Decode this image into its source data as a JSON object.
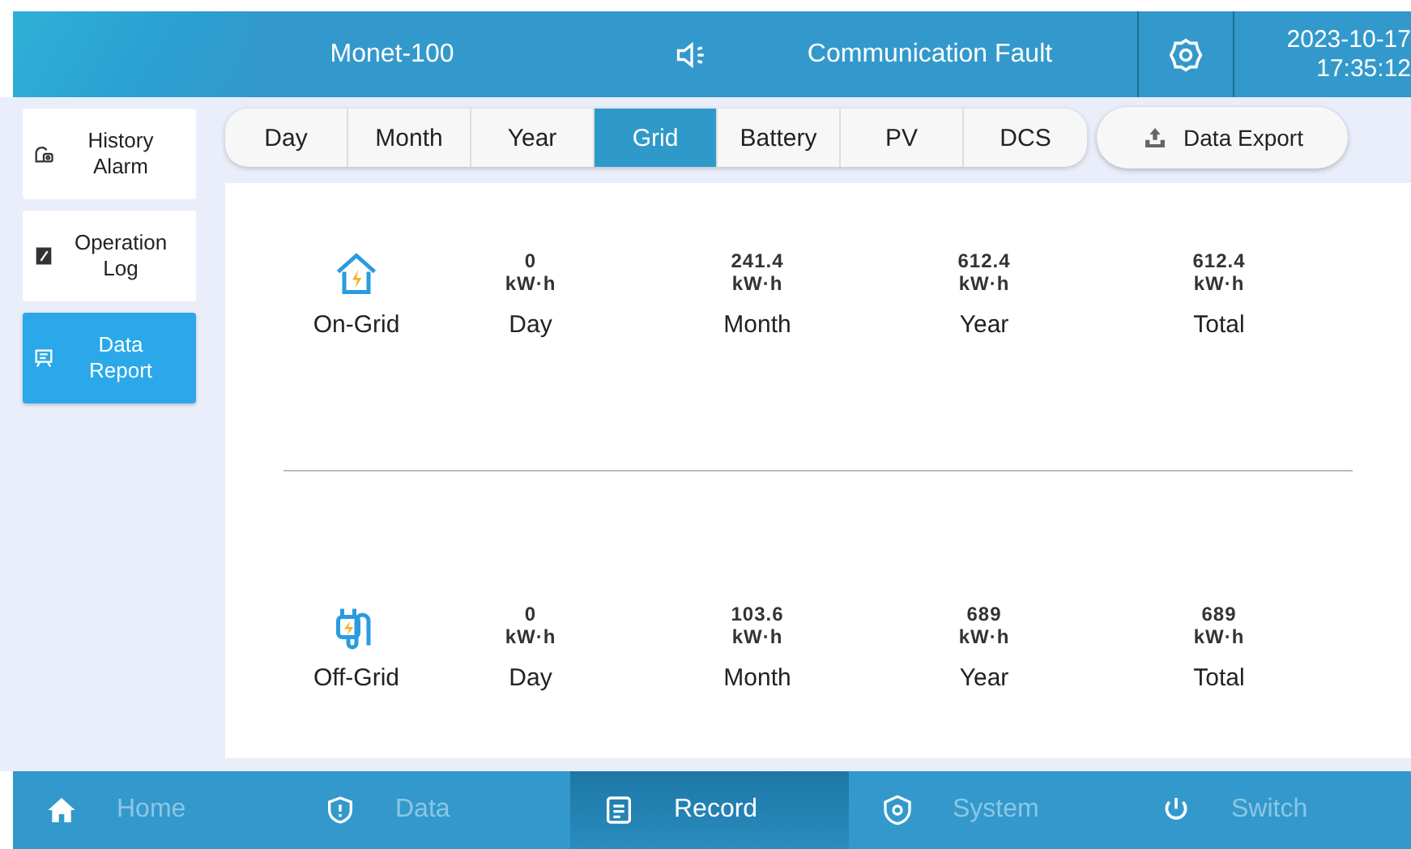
{
  "header": {
    "device": "Monet-100",
    "alarm": "Communication Fault",
    "date": "2023-10-17",
    "time": "17:35:12"
  },
  "sidebar": {
    "items": [
      {
        "label": "History Alarm",
        "kind": "alarm",
        "selected": false
      },
      {
        "label": "Operation Log",
        "kind": "log",
        "selected": false
      },
      {
        "label": "Data Report",
        "kind": "report",
        "selected": true
      }
    ]
  },
  "tabs": [
    {
      "label": "Day",
      "selected": false
    },
    {
      "label": "Month",
      "selected": false
    },
    {
      "label": "Year",
      "selected": false
    },
    {
      "label": "Grid",
      "selected": true
    },
    {
      "label": "Battery",
      "selected": false
    },
    {
      "label": "PV",
      "selected": false
    },
    {
      "label": "DCS",
      "selected": false
    }
  ],
  "export_button": "Data Export",
  "sections": [
    {
      "kind": "house",
      "label": "On-Grid",
      "stats": [
        {
          "value": "0",
          "unit": "kW·h",
          "label": "Day"
        },
        {
          "value": "241.4",
          "unit": "kW·h",
          "label": "Month"
        },
        {
          "value": "612.4",
          "unit": "kW·h",
          "label": "Year"
        },
        {
          "value": "612.4",
          "unit": "kW·h",
          "label": "Total"
        }
      ]
    },
    {
      "kind": "plug",
      "label": "Off-Grid",
      "stats": [
        {
          "value": "0",
          "unit": "kW·h",
          "label": "Day"
        },
        {
          "value": "103.6",
          "unit": "kW·h",
          "label": "Month"
        },
        {
          "value": "689",
          "unit": "kW·h",
          "label": "Year"
        },
        {
          "value": "689",
          "unit": "kW·h",
          "label": "Total"
        }
      ]
    }
  ],
  "nav": [
    {
      "label": "Home",
      "kind": "home",
      "selected": false
    },
    {
      "label": "Data",
      "kind": "data",
      "selected": false
    },
    {
      "label": "Record",
      "kind": "record",
      "selected": true
    },
    {
      "label": "System",
      "kind": "system",
      "selected": false
    },
    {
      "label": "Switch",
      "kind": "power",
      "selected": false
    }
  ]
}
